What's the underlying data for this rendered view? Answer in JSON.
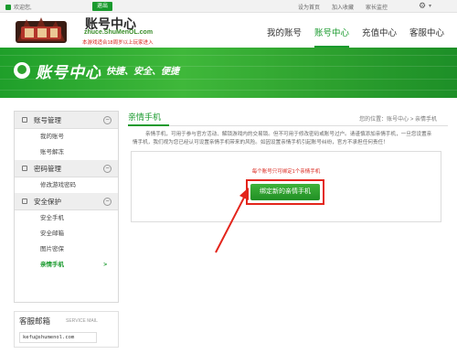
{
  "topbar": {
    "welcome": "欢迎您,",
    "logout": "退出",
    "links": [
      "设为首页",
      "加入收藏",
      "家长监控"
    ]
  },
  "header": {
    "logo_title": "账号中心",
    "logo_domain": "zhuce.ShuMenOL.com",
    "logo_note": "本游戏适合18周岁以上玩家进入",
    "nav": [
      "我的账号",
      "账号中心",
      "充值中心",
      "客服中心"
    ],
    "nav_active": 1
  },
  "banner": {
    "title": "账号中心",
    "slogan": "快捷、安全、便捷"
  },
  "sidebar": {
    "sections": [
      {
        "label": "账号管理",
        "items": [
          "我的账号",
          "账号解冻"
        ]
      },
      {
        "label": "密码管理",
        "items": [
          "修改游戏密码"
        ]
      },
      {
        "label": "安全保护",
        "items": [
          "安全手机",
          "安全邮箱",
          "图片密保",
          "亲情手机"
        ]
      }
    ],
    "active_item": "亲情手机",
    "active_marker": ">"
  },
  "support": {
    "title": "客服邮箱",
    "subtitle": "SERVICE MAIL",
    "email": "kefu@shumenol.com"
  },
  "main": {
    "title": "亲情手机",
    "breadcrumb": "您的位置：账号中心 > 亲情手机",
    "description": "亲情手机，可用于参与官方活动、解锁游戏内的交易锁。但不可用于修改密码或账号过户。请谨慎添加亲情手机，一旦您设置亲情手机，我们视为您已经认可设置亲情手机带来的风险。如因设置亲情手机引起账号纠纷，官方不承担任何责任！",
    "limit_note": "每个账号只可绑定1个亲情手机",
    "bind_button": "绑定新的亲情手机"
  },
  "colors": {
    "brand_green": "#1a9a2e",
    "alert_red": "#e3251c"
  }
}
